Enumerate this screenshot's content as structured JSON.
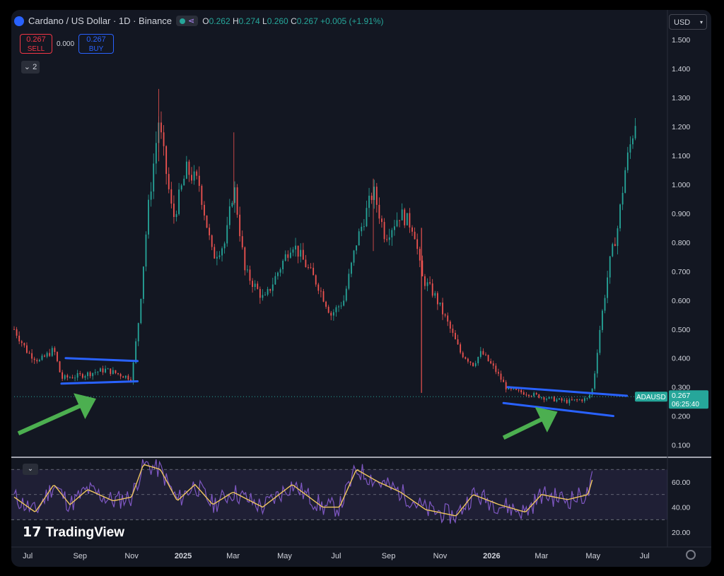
{
  "header": {
    "symbol_title": "Cardano / US Dollar · 1D · Binance",
    "ohlc": {
      "o_label": "O",
      "o": "0.262",
      "h_label": "H",
      "h": "0.274",
      "l_label": "L",
      "l": "0.260",
      "c_label": "C",
      "c": "0.267",
      "change": "+0.005 (+1.91%)"
    },
    "sell_price": "0.267",
    "sell_label": "SELL",
    "spread": "0.000",
    "buy_price": "0.267",
    "buy_label": "BUY",
    "indicators_count": "2",
    "currency": "USD"
  },
  "branding": {
    "logo_text": "TradingView"
  },
  "price_tag": {
    "symbol": "ADAUSD",
    "price": "0.267",
    "countdown": "06:25:40"
  },
  "colors": {
    "up": "#26a69a",
    "down": "#ef5350",
    "trendline": "#2962ff",
    "arrow": "#4caf50",
    "rsi": "#7e57c2",
    "rsi_ma": "#f0c75e",
    "background": "#131722"
  },
  "chart_data": {
    "type": "candlestick",
    "title": "Cardano / US Dollar · 1D · Binance",
    "x_ticks": [
      "Jul",
      "Sep",
      "Nov",
      "2025",
      "Mar",
      "May",
      "Jul",
      "Sep",
      "Nov",
      "2026",
      "Mar",
      "May",
      "Jul"
    ],
    "y_ticks": [
      "0.100",
      "0.200",
      "0.300",
      "0.400",
      "0.500",
      "0.600",
      "0.700",
      "0.800",
      "0.900",
      "1.000",
      "1.100",
      "1.200",
      "1.300",
      "1.400",
      "1.500"
    ],
    "ylim": [
      0.06,
      1.52
    ],
    "last_price": 0.267,
    "price_path": [
      [
        "2024-06-15",
        0.5
      ],
      [
        "2024-07-01",
        0.42
      ],
      [
        "2024-07-15",
        0.39
      ],
      [
        "2024-08-01",
        0.43
      ],
      [
        "2024-08-10",
        0.33
      ],
      [
        "2024-09-01",
        0.34
      ],
      [
        "2024-10-01",
        0.36
      ],
      [
        "2024-11-01",
        0.33
      ],
      [
        "2024-11-10",
        0.55
      ],
      [
        "2024-11-20",
        0.9
      ],
      [
        "2024-12-03",
        1.22
      ],
      [
        "2024-12-20",
        0.88
      ],
      [
        "2025-01-05",
        1.05
      ],
      [
        "2025-01-20",
        1.0
      ],
      [
        "2025-02-05",
        0.75
      ],
      [
        "2025-02-20",
        0.8
      ],
      [
        "2025-03-02",
        1.0
      ],
      [
        "2025-03-15",
        0.7
      ],
      [
        "2025-04-07",
        0.6
      ],
      [
        "2025-05-10",
        0.8
      ],
      [
        "2025-06-10",
        0.65
      ],
      [
        "2025-06-25",
        0.55
      ],
      [
        "2025-07-10",
        0.6
      ],
      [
        "2025-07-25",
        0.8
      ],
      [
        "2025-08-14",
        0.98
      ],
      [
        "2025-08-28",
        0.82
      ],
      [
        "2025-09-15",
        0.9
      ],
      [
        "2025-10-01",
        0.85
      ],
      [
        "2025-10-10",
        0.68
      ],
      [
        "2025-10-25",
        0.62
      ],
      [
        "2025-11-10",
        0.52
      ],
      [
        "2025-11-25",
        0.42
      ],
      [
        "2025-12-10",
        0.38
      ],
      [
        "2025-12-20",
        0.42
      ],
      [
        "2026-01-05",
        0.36
      ],
      [
        "2026-01-20",
        0.29
      ],
      [
        "2026-02-10",
        0.28
      ],
      [
        "2026-03-10",
        0.26
      ],
      [
        "2026-04-01",
        0.25
      ],
      [
        "2026-04-25",
        0.26
      ],
      [
        "2026-05-01",
        0.3
      ],
      [
        "2026-05-08",
        0.48
      ],
      [
        "2026-05-20",
        0.72
      ],
      [
        "2026-05-30",
        0.85
      ],
      [
        "2026-06-08",
        1.05
      ],
      [
        "2026-06-15",
        1.15
      ],
      [
        "2026-06-20",
        1.22
      ]
    ],
    "annotations": {
      "trendlines": [
        {
          "from": [
            "2024-08-15",
            0.4
          ],
          "to": [
            "2024-11-08",
            0.39
          ]
        },
        {
          "from": [
            "2024-08-10",
            0.312
          ],
          "to": [
            "2024-11-08",
            0.32
          ]
        },
        {
          "from": [
            "2026-01-20",
            0.3
          ],
          "to": [
            "2026-06-10",
            0.27
          ]
        },
        {
          "from": [
            "2026-01-15",
            0.245
          ],
          "to": [
            "2026-05-25",
            0.2
          ]
        }
      ],
      "arrows": [
        {
          "from": [
            "2024-06-20",
            0.14
          ],
          "to": [
            "2024-09-20",
            0.26
          ]
        },
        {
          "from": [
            "2026-01-15",
            0.125
          ],
          "to": [
            "2026-03-20",
            0.215
          ]
        }
      ]
    },
    "rsi": {
      "y_ticks": [
        "20.00",
        "40.00",
        "60.00"
      ],
      "ylim": [
        15,
        78
      ],
      "bands": [
        30,
        50,
        70
      ],
      "path": [
        [
          "2024-06-15",
          48
        ],
        [
          "2024-07-10",
          36
        ],
        [
          "2024-08-01",
          58
        ],
        [
          "2024-08-20",
          42
        ],
        [
          "2024-09-10",
          54
        ],
        [
          "2024-10-10",
          45
        ],
        [
          "2024-11-01",
          48
        ],
        [
          "2024-11-15",
          74
        ],
        [
          "2024-12-05",
          70
        ],
        [
          "2024-12-25",
          45
        ],
        [
          "2025-01-15",
          58
        ],
        [
          "2025-02-05",
          42
        ],
        [
          "2025-03-01",
          52
        ],
        [
          "2025-04-05",
          40
        ],
        [
          "2025-05-10",
          58
        ],
        [
          "2025-06-15",
          40
        ],
        [
          "2025-07-05",
          40
        ],
        [
          "2025-07-25",
          70
        ],
        [
          "2025-08-20",
          60
        ],
        [
          "2025-09-15",
          52
        ],
        [
          "2025-10-15",
          38
        ],
        [
          "2025-11-20",
          33
        ],
        [
          "2025-12-10",
          50
        ],
        [
          "2026-01-10",
          42
        ],
        [
          "2026-02-10",
          36
        ],
        [
          "2026-03-01",
          50
        ],
        [
          "2026-04-01",
          46
        ],
        [
          "2026-04-25",
          50
        ],
        [
          "2026-05-01",
          64
        ]
      ]
    }
  }
}
